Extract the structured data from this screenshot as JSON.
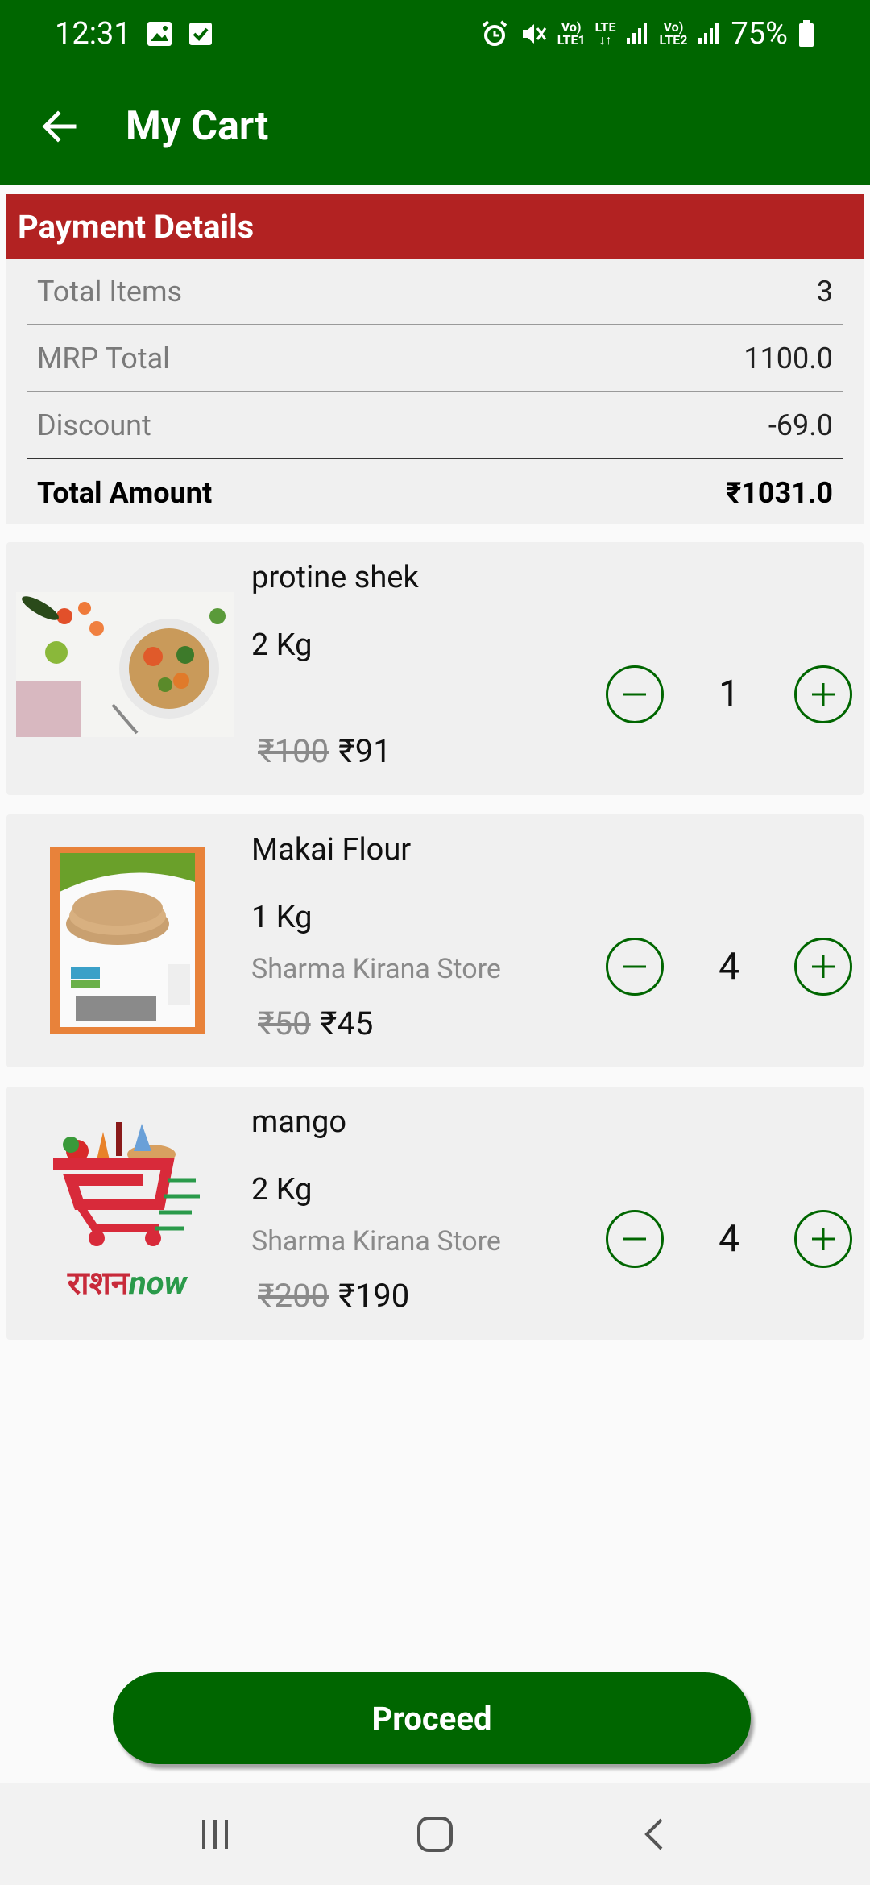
{
  "status_bar": {
    "time": "12:31",
    "battery": "75%"
  },
  "app_bar": {
    "title": "My Cart"
  },
  "payment": {
    "header": "Payment Details",
    "rows": [
      {
        "label": "Total Items",
        "value": "3"
      },
      {
        "label": "MRP Total",
        "value": "1100.0"
      },
      {
        "label": "Discount",
        "value": "-69.0"
      },
      {
        "label": "Total Amount",
        "value": "₹1031.0"
      }
    ]
  },
  "items": [
    {
      "name": "protine shek",
      "weight": "2 Kg",
      "store": "",
      "mrp": "₹100",
      "price": "₹91",
      "qty": "1"
    },
    {
      "name": "Makai Flour",
      "weight": "1 Kg",
      "store": "Sharma Kirana Store",
      "mrp": "₹50",
      "price": "₹45",
      "qty": "4"
    },
    {
      "name": "mango",
      "weight": "2 Kg",
      "store": "Sharma Kirana Store",
      "mrp": "₹200",
      "price": "₹190",
      "qty": "4"
    }
  ],
  "logo_text": {
    "part1": "राशन",
    "part2": "now"
  },
  "proceed_label": "Proceed",
  "colors": {
    "primary": "#006600",
    "header_red": "#b22222"
  }
}
